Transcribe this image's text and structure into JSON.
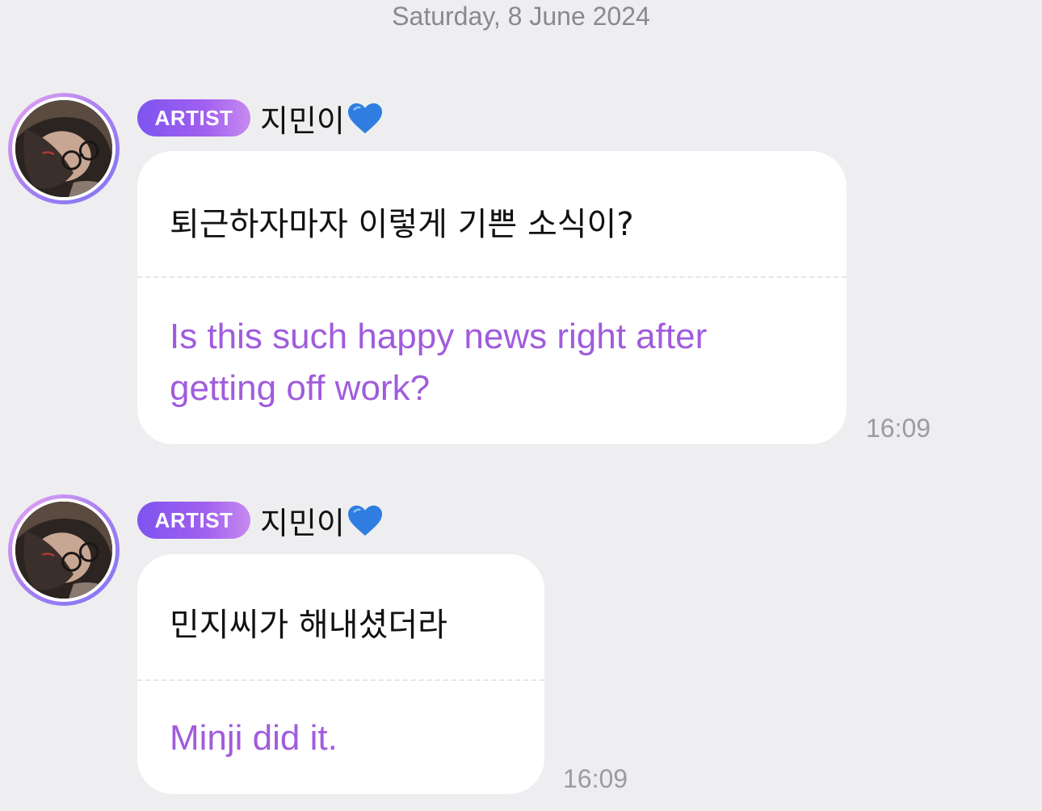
{
  "date_separator": "Saturday, 8 June 2024",
  "colors": {
    "background": "#eeeef0",
    "badge_gradient_start": "#7d54f0",
    "badge_gradient_end": "#c78af0",
    "translation_text": "#a05cdc",
    "heart": "#2f7de0"
  },
  "messages": [
    {
      "badge": "ARTIST",
      "sender": "지민이",
      "sender_icon": "blue-heart-icon",
      "original": "퇴근하자마자 이렇게 기쁜 소식이?",
      "translation": "Is this such happy news right after getting off work?",
      "time": "16:09"
    },
    {
      "badge": "ARTIST",
      "sender": "지민이",
      "sender_icon": "blue-heart-icon",
      "original": "민지씨가 해내셨더라",
      "translation": "Minji did it.",
      "time": "16:09"
    }
  ]
}
